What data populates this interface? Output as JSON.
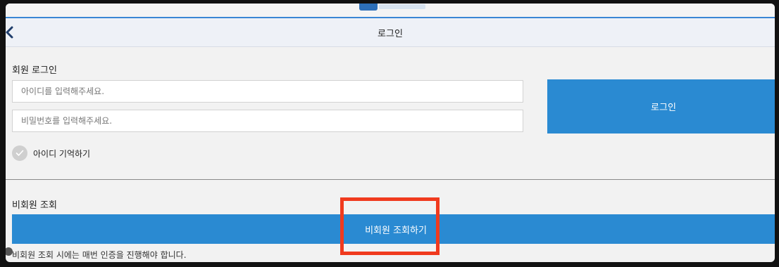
{
  "header": {
    "title": "로그인"
  },
  "member_login": {
    "section_title": "회원 로그인",
    "id_placeholder": "아이디를 입력해주세요.",
    "password_placeholder": "비밀번호를 입력해주세요.",
    "login_label": "로그인",
    "remember_label": "아이디 기억하기"
  },
  "guest": {
    "section_title": "비회원 조회",
    "button_label": "비회원 조회하기",
    "note": "비회원 조회 시에는 매번 인증을 진행해야 합니다."
  },
  "colors": {
    "primary": "#2a8ad2",
    "highlight": "#f03a1e"
  },
  "icons": {
    "back": "chevron-left-icon",
    "check": "check-icon",
    "logo": "logo-icon"
  }
}
